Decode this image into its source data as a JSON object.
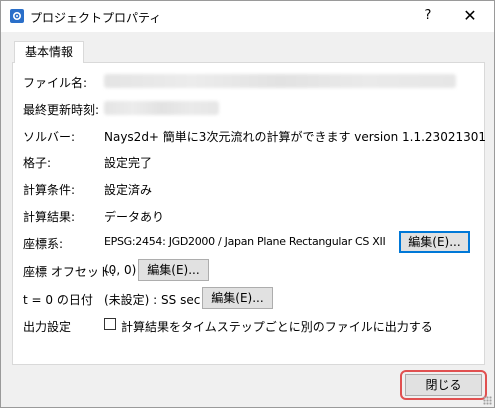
{
  "window": {
    "title": "プロジェクトプロパティ",
    "help": "?",
    "close": "✕"
  },
  "tabs": [
    {
      "label": "基本情報",
      "active": true
    }
  ],
  "fields": {
    "filename": {
      "label": "ファイル名:"
    },
    "modified": {
      "label": "最終更新時刻:"
    },
    "solver": {
      "label": "ソルバー:",
      "value": "Nays2d+ 簡単に3次元流れの計算ができます version 1.1.23021301"
    },
    "grid": {
      "label": "格子:",
      "value": "設定完了"
    },
    "calc_conditions": {
      "label": "計算条件:",
      "value": "設定済み"
    },
    "calc_results": {
      "label": "計算結果:",
      "value": "データあり"
    },
    "crs": {
      "label": "座標系:",
      "value": "EPSG:2454: JGD2000 / Japan Plane Rectangular CS XII",
      "button": "編集(E)..."
    },
    "offset": {
      "label": "座標 オフセット:",
      "value": "(0, 0)",
      "button": "編集(E)..."
    },
    "t0_date": {
      "label": "t = 0 の日付",
      "value": "(未設定) : SS sec",
      "button": "編集(E)..."
    },
    "output": {
      "label": "出力設定",
      "checkbox_label": "計算結果をタイムステップごとに別のファイルに出力する",
      "checked": false
    }
  },
  "footer": {
    "close_label": "閉じる"
  }
}
